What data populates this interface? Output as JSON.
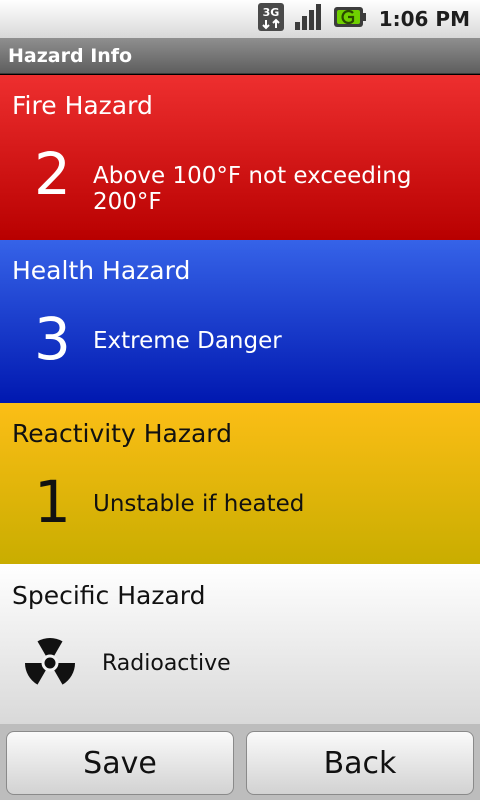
{
  "status_bar": {
    "network_icon": "3g-data-icon",
    "signal_icon": "signal-strength-icon",
    "battery_icon": "battery-charging-icon",
    "time": "1:06 PM"
  },
  "app": {
    "title": "Hazard Info"
  },
  "panels": {
    "fire": {
      "title": "Fire Hazard",
      "rating": "2",
      "description": "Above 100°F not exceeding 200°F",
      "color": "#d01010"
    },
    "health": {
      "title": "Health Hazard",
      "rating": "3",
      "description": "Extreme Danger",
      "color": "#1034d0"
    },
    "reactivity": {
      "title": "Reactivity Hazard",
      "rating": "1",
      "description": "Unstable if heated",
      "color": "#e8b60a"
    },
    "specific": {
      "title": "Specific Hazard",
      "icon": "radioactive-icon",
      "description": "Radioactive"
    }
  },
  "buttons": {
    "save_label": "Save",
    "back_label": "Back"
  }
}
